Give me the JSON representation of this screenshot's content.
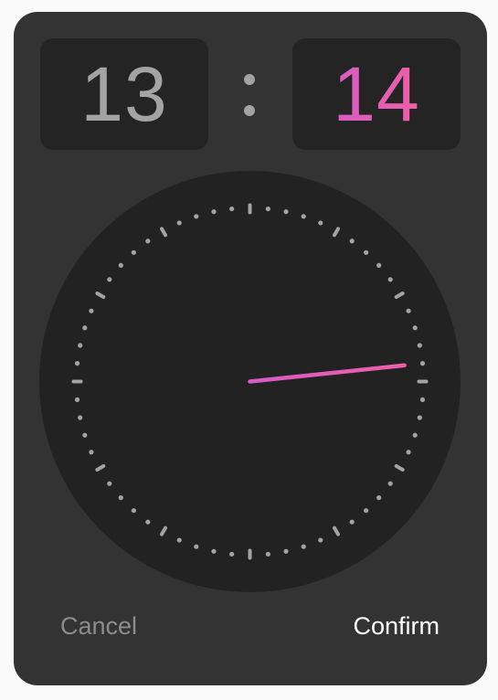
{
  "time_picker": {
    "hour": "13",
    "minute": "14",
    "minute_value": 14
  },
  "actions": {
    "cancel_label": "Cancel",
    "confirm_label": "Confirm"
  },
  "colors": {
    "dialog_background": "#333333",
    "display_background": "#242424",
    "clock_face": "#222222",
    "tick_marks": "#a3a3a3",
    "hand_gradient_start": "#d65cc4",
    "hand_gradient_end": "#ef5fa6"
  }
}
